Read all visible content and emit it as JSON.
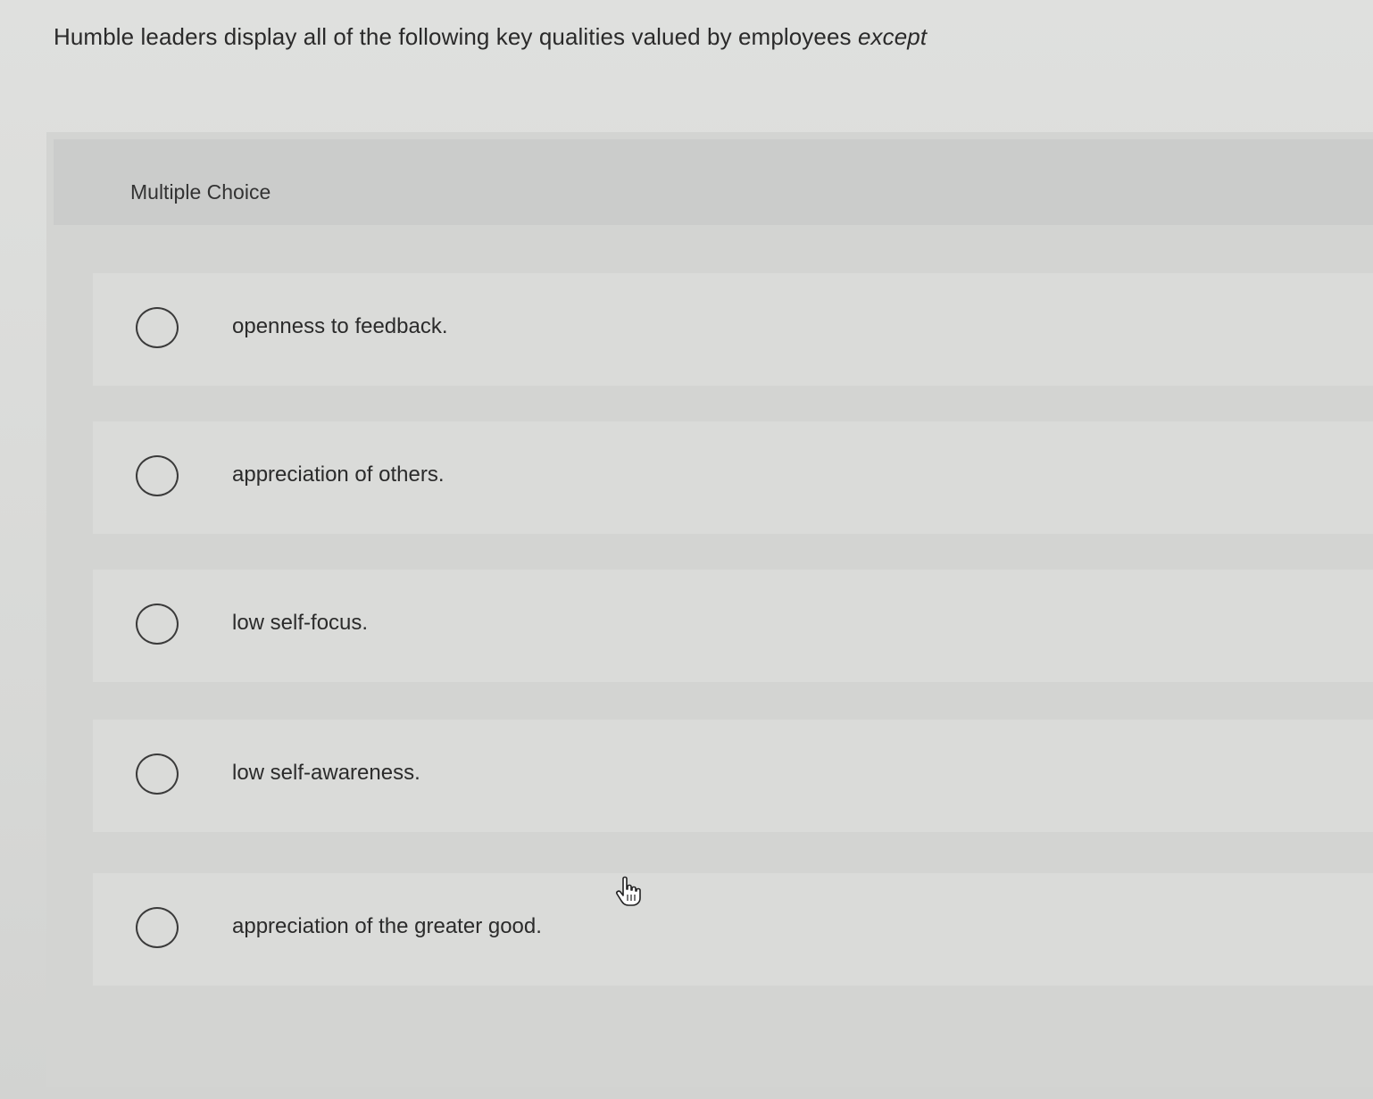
{
  "question": {
    "text": "Humble leaders display all of the following key qualities valued by employees",
    "emphasis": "except"
  },
  "mc": {
    "label": "Multiple Choice",
    "options": [
      {
        "label": "openness to feedback.",
        "selected": false
      },
      {
        "label": "appreciation of others.",
        "selected": false
      },
      {
        "label": "low self-focus.",
        "selected": false
      },
      {
        "label": "low self-awareness.",
        "selected": false
      },
      {
        "label": "appreciation of the greater good.",
        "selected": false
      }
    ]
  },
  "cursor": {
    "icon": "hand-pointer-icon"
  }
}
